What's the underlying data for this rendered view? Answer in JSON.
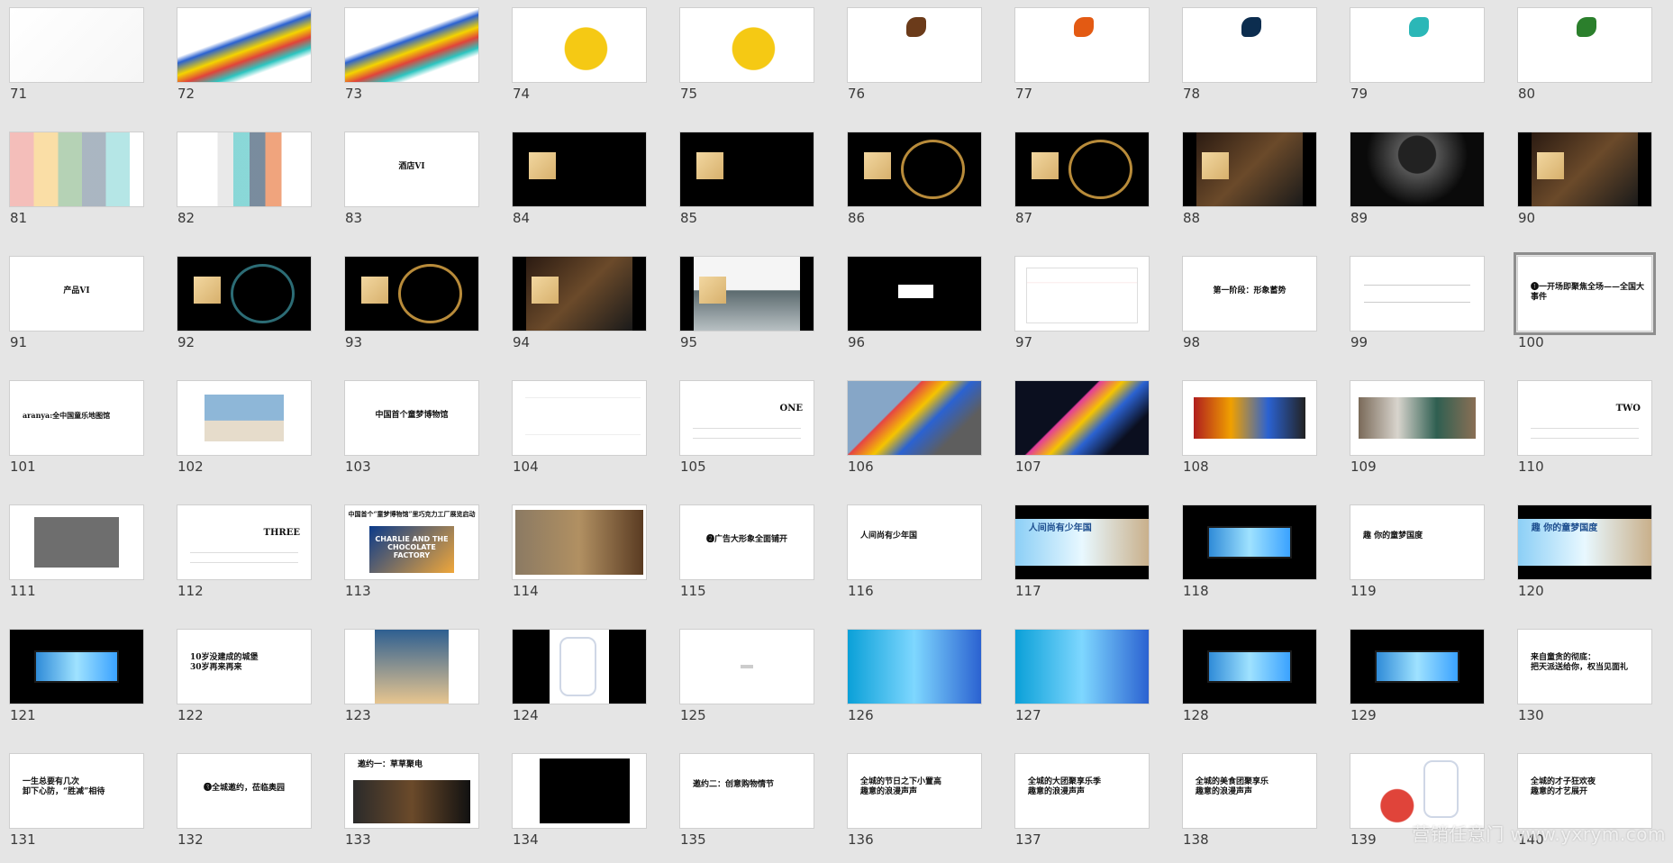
{
  "selected": "100",
  "slides": [
    {
      "n": "71",
      "kind": "white-sketch"
    },
    {
      "n": "72",
      "kind": "wave-color"
    },
    {
      "n": "73",
      "kind": "wave-color-2"
    },
    {
      "n": "74",
      "kind": "yellow-cards"
    },
    {
      "n": "75",
      "kind": "yellow-card-sketch"
    },
    {
      "n": "76",
      "kind": "bird-brown"
    },
    {
      "n": "77",
      "kind": "bird-orange"
    },
    {
      "n": "78",
      "kind": "bird-navy"
    },
    {
      "n": "79",
      "kind": "bird-teal"
    },
    {
      "n": "80",
      "kind": "bird-green"
    },
    {
      "n": "81",
      "kind": "vi-colors"
    },
    {
      "n": "82",
      "kind": "vi-banners"
    },
    {
      "n": "83",
      "kind": "title",
      "title": "酒店VI"
    },
    {
      "n": "84",
      "kind": "dark-card"
    },
    {
      "n": "85",
      "kind": "dark-card-2"
    },
    {
      "n": "86",
      "kind": "dark-ring"
    },
    {
      "n": "87",
      "kind": "dark-ring-2"
    },
    {
      "n": "88",
      "kind": "dark-photo"
    },
    {
      "n": "89",
      "kind": "umbrella"
    },
    {
      "n": "90",
      "kind": "hotel-entrance"
    },
    {
      "n": "91",
      "kind": "title",
      "title": "产品VI"
    },
    {
      "n": "92",
      "kind": "teal-ring"
    },
    {
      "n": "93",
      "kind": "gold-ring"
    },
    {
      "n": "94",
      "kind": "room-photo"
    },
    {
      "n": "95",
      "kind": "courtyard"
    },
    {
      "n": "96",
      "kind": "black-box"
    },
    {
      "n": "97",
      "kind": "schedule"
    },
    {
      "n": "98",
      "kind": "title",
      "title": "第一阶段：形象蓄势"
    },
    {
      "n": "99",
      "kind": "text-lines"
    },
    {
      "n": "100",
      "kind": "title-left",
      "title": "❶一开场即聚焦全场——全国大事件"
    },
    {
      "n": "101",
      "kind": "title-left-2",
      "title": "aranya:全中国童乐地图馆"
    },
    {
      "n": "102",
      "kind": "landscape"
    },
    {
      "n": "103",
      "kind": "title",
      "title": "中国首个童梦博物馆"
    },
    {
      "n": "104",
      "kind": "paragraph"
    },
    {
      "n": "105",
      "kind": "right-title",
      "title": "ONE"
    },
    {
      "n": "106",
      "kind": "color-house"
    },
    {
      "n": "107",
      "kind": "color-house-night"
    },
    {
      "n": "108",
      "kind": "market"
    },
    {
      "n": "109",
      "kind": "storefronts"
    },
    {
      "n": "110",
      "kind": "right-title",
      "title": "TWO"
    },
    {
      "n": "111",
      "kind": "phones"
    },
    {
      "n": "112",
      "kind": "right-title",
      "title": "THREE"
    },
    {
      "n": "113",
      "kind": "charlie",
      "title": "中国首个“童梦博物馆”里巧克力工厂展览启动",
      "inner": "CHARLIE AND THE CHOCOLATE FACTORY"
    },
    {
      "n": "114",
      "kind": "bikes"
    },
    {
      "n": "115",
      "kind": "title",
      "title": "❷广告大形象全面铺开"
    },
    {
      "n": "116",
      "kind": "title-left",
      "title": "人间尚有少年国"
    },
    {
      "n": "117",
      "kind": "banner",
      "title": "人间尚有少年国"
    },
    {
      "n": "118",
      "kind": "billboard"
    },
    {
      "n": "119",
      "kind": "title-left",
      "title": "趣 你的童梦国度"
    },
    {
      "n": "120",
      "kind": "banner-2",
      "title": "趣 你的童梦国度"
    },
    {
      "n": "121",
      "kind": "billboard-night"
    },
    {
      "n": "122",
      "kind": "title-left-3",
      "title": "10岁没建成的城堡\n30岁再来再来"
    },
    {
      "n": "123",
      "kind": "poster"
    },
    {
      "n": "124",
      "kind": "phone"
    },
    {
      "n": "125",
      "kind": "small-center"
    },
    {
      "n": "126",
      "kind": "blue-banner"
    },
    {
      "n": "127",
      "kind": "blue-banner-2"
    },
    {
      "n": "128",
      "kind": "billboard-city"
    },
    {
      "n": "129",
      "kind": "billboard-city-2"
    },
    {
      "n": "130",
      "kind": "title-left-3",
      "title": "来自童贪的彻底：\n把天派送给你，权当见面礼"
    },
    {
      "n": "131",
      "kind": "title-left-3",
      "title": "一生总要有几次\n卸下心防，“胜减”相待"
    },
    {
      "n": "132",
      "kind": "title",
      "title": "❸全城邀约，莅临奥园"
    },
    {
      "n": "133",
      "kind": "sculptures",
      "title": "邀约一：草草聚电"
    },
    {
      "n": "134",
      "kind": "black-panel"
    },
    {
      "n": "135",
      "kind": "title-left",
      "title": "邀约二：创意购物情节"
    },
    {
      "n": "136",
      "kind": "title-left-3",
      "title": "全城的节日之下小置高\n趣意的浪漫声声"
    },
    {
      "n": "137",
      "kind": "title-left-3",
      "title": "全城的大团聚享乐季\n趣意的浪漫声声"
    },
    {
      "n": "138",
      "kind": "title-left-3",
      "title": "全城的美食团聚享乐\n趣意的浪漫声声"
    },
    {
      "n": "139",
      "kind": "lobster"
    },
    {
      "n": "140",
      "kind": "title-left-3",
      "title": "全城的才子狂欢夜\n趣意的才艺展开"
    }
  ],
  "watermark": "营销任意门 www.yxrym.com"
}
